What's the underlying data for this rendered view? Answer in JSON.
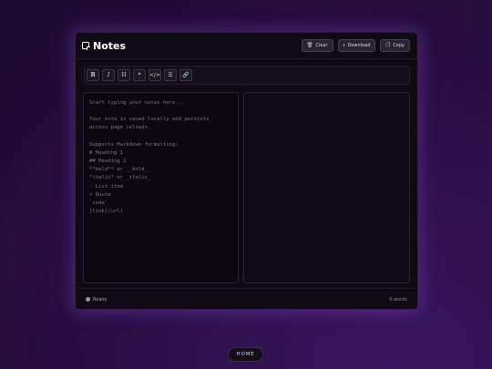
{
  "app": {
    "title": "Notes"
  },
  "header": {
    "clear_label": "Clear",
    "download_label": "Download",
    "copy_label": "Copy"
  },
  "toolbar": {
    "buttons": [
      {
        "name": "bold",
        "label": "B"
      },
      {
        "name": "italic",
        "label": "I"
      },
      {
        "name": "heading",
        "label": "H"
      },
      {
        "name": "quote",
        "label": "❝"
      },
      {
        "name": "code",
        "label": "</>"
      },
      {
        "name": "list",
        "label": "☰"
      },
      {
        "name": "link",
        "label": "🔗"
      }
    ]
  },
  "editor": {
    "placeholder": "Start typing your notes here...\n\nYour note is saved locally and persists\nacross page reloads.\n\nSupports Markdown formatting:\n# Heading 1\n## Heading 2\n**bold** or __bold__\n*italic* or _italic_\n- List item\n> Quote\n`code`\n[link](url)"
  },
  "footer": {
    "status": "Ready",
    "word_count": "0 words"
  },
  "nav": {
    "home_label": "HOME"
  },
  "colors": {
    "accent_glow": "#9650e6",
    "background": "#2a1048",
    "panel": "#0f0a16"
  }
}
